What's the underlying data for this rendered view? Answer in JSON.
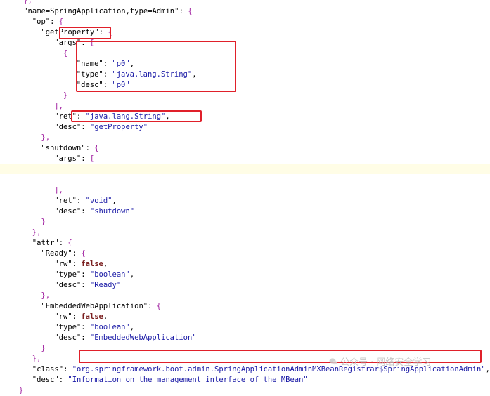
{
  "lines": [
    {
      "i": 4,
      "seg": [
        {
          "c": "p",
          "t": "},"
        }
      ]
    },
    {
      "i": 4,
      "seg": [
        {
          "c": "k",
          "t": "\"name=SpringApplication,type=Admin\""
        },
        {
          "c": "k",
          "t": ": "
        },
        {
          "c": "p",
          "t": "{"
        }
      ]
    },
    {
      "i": 6,
      "seg": [
        {
          "c": "k",
          "t": "\"op\""
        },
        {
          "c": "k",
          "t": ": "
        },
        {
          "c": "p",
          "t": "{"
        }
      ]
    },
    {
      "i": 8,
      "seg": [
        {
          "c": "k",
          "t": "\"getProperty\""
        },
        {
          "c": "k",
          "t": ": "
        },
        {
          "c": "p",
          "t": "{"
        }
      ]
    },
    {
      "i": 11,
      "seg": [
        {
          "c": "k",
          "t": "\"args\""
        },
        {
          "c": "k",
          "t": ": "
        },
        {
          "c": "p",
          "t": "["
        }
      ]
    },
    {
      "i": 13,
      "seg": [
        {
          "c": "p",
          "t": "{"
        }
      ]
    },
    {
      "i": 16,
      "seg": [
        {
          "c": "k",
          "t": "\"name\""
        },
        {
          "c": "k",
          "t": ": "
        },
        {
          "c": "s",
          "t": "\"p0\""
        },
        {
          "c": "k",
          "t": ","
        }
      ]
    },
    {
      "i": 16,
      "seg": [
        {
          "c": "k",
          "t": "\"type\""
        },
        {
          "c": "k",
          "t": ": "
        },
        {
          "c": "s",
          "t": "\"java.lang.String\""
        },
        {
          "c": "k",
          "t": ","
        }
      ]
    },
    {
      "i": 16,
      "seg": [
        {
          "c": "k",
          "t": "\"desc\""
        },
        {
          "c": "k",
          "t": ": "
        },
        {
          "c": "s",
          "t": "\"p0\""
        }
      ]
    },
    {
      "i": 13,
      "seg": [
        {
          "c": "p",
          "t": "}"
        }
      ]
    },
    {
      "i": 11,
      "seg": [
        {
          "c": "p",
          "t": "],"
        }
      ]
    },
    {
      "i": 11,
      "seg": [
        {
          "c": "k",
          "t": "\"ret\""
        },
        {
          "c": "k",
          "t": ": "
        },
        {
          "c": "s",
          "t": "\"java.lang.String\""
        },
        {
          "c": "k",
          "t": ","
        }
      ]
    },
    {
      "i": 11,
      "seg": [
        {
          "c": "k",
          "t": "\"desc\""
        },
        {
          "c": "k",
          "t": ": "
        },
        {
          "c": "s",
          "t": "\"getProperty\""
        }
      ]
    },
    {
      "i": 8,
      "seg": [
        {
          "c": "p",
          "t": "},"
        }
      ]
    },
    {
      "i": 8,
      "seg": [
        {
          "c": "k",
          "t": "\"shutdown\""
        },
        {
          "c": "k",
          "t": ": "
        },
        {
          "c": "p",
          "t": "{"
        }
      ]
    },
    {
      "i": 11,
      "seg": [
        {
          "c": "k",
          "t": "\"args\""
        },
        {
          "c": "k",
          "t": ": "
        },
        {
          "c": "p",
          "t": "["
        }
      ]
    },
    {
      "i": 0,
      "seg": []
    },
    {
      "i": 0,
      "seg": []
    },
    {
      "i": 11,
      "seg": [
        {
          "c": "p",
          "t": "],"
        }
      ]
    },
    {
      "i": 11,
      "seg": [
        {
          "c": "k",
          "t": "\"ret\""
        },
        {
          "c": "k",
          "t": ": "
        },
        {
          "c": "s",
          "t": "\"void\""
        },
        {
          "c": "k",
          "t": ","
        }
      ]
    },
    {
      "i": 11,
      "seg": [
        {
          "c": "k",
          "t": "\"desc\""
        },
        {
          "c": "k",
          "t": ": "
        },
        {
          "c": "s",
          "t": "\"shutdown\""
        }
      ]
    },
    {
      "i": 8,
      "seg": [
        {
          "c": "p",
          "t": "}"
        }
      ]
    },
    {
      "i": 6,
      "seg": [
        {
          "c": "p",
          "t": "},"
        }
      ]
    },
    {
      "i": 6,
      "seg": [
        {
          "c": "k",
          "t": "\"attr\""
        },
        {
          "c": "k",
          "t": ": "
        },
        {
          "c": "p",
          "t": "{"
        }
      ]
    },
    {
      "i": 8,
      "seg": [
        {
          "c": "k",
          "t": "\"Ready\""
        },
        {
          "c": "k",
          "t": ": "
        },
        {
          "c": "p",
          "t": "{"
        }
      ]
    },
    {
      "i": 11,
      "seg": [
        {
          "c": "k",
          "t": "\"rw\""
        },
        {
          "c": "k",
          "t": ": "
        },
        {
          "c": "kw",
          "t": "false"
        },
        {
          "c": "k",
          "t": ","
        }
      ]
    },
    {
      "i": 11,
      "seg": [
        {
          "c": "k",
          "t": "\"type\""
        },
        {
          "c": "k",
          "t": ": "
        },
        {
          "c": "s",
          "t": "\"boolean\""
        },
        {
          "c": "k",
          "t": ","
        }
      ]
    },
    {
      "i": 11,
      "seg": [
        {
          "c": "k",
          "t": "\"desc\""
        },
        {
          "c": "k",
          "t": ": "
        },
        {
          "c": "s",
          "t": "\"Ready\""
        }
      ]
    },
    {
      "i": 8,
      "seg": [
        {
          "c": "p",
          "t": "},"
        }
      ]
    },
    {
      "i": 8,
      "seg": [
        {
          "c": "k",
          "t": "\"EmbeddedWebApplication\""
        },
        {
          "c": "k",
          "t": ": "
        },
        {
          "c": "p",
          "t": "{"
        }
      ]
    },
    {
      "i": 11,
      "seg": [
        {
          "c": "k",
          "t": "\"rw\""
        },
        {
          "c": "k",
          "t": ": "
        },
        {
          "c": "kw",
          "t": "false"
        },
        {
          "c": "k",
          "t": ","
        }
      ]
    },
    {
      "i": 11,
      "seg": [
        {
          "c": "k",
          "t": "\"type\""
        },
        {
          "c": "k",
          "t": ": "
        },
        {
          "c": "s",
          "t": "\"boolean\""
        },
        {
          "c": "k",
          "t": ","
        }
      ]
    },
    {
      "i": 11,
      "seg": [
        {
          "c": "k",
          "t": "\"desc\""
        },
        {
          "c": "k",
          "t": ": "
        },
        {
          "c": "s",
          "t": "\"EmbeddedWebApplication\""
        }
      ]
    },
    {
      "i": 8,
      "seg": [
        {
          "c": "p",
          "t": "}"
        }
      ]
    },
    {
      "i": 6,
      "seg": [
        {
          "c": "p",
          "t": "},"
        }
      ]
    },
    {
      "i": 6,
      "seg": [
        {
          "c": "k",
          "t": "\"class\""
        },
        {
          "c": "k",
          "t": ": "
        },
        {
          "c": "s",
          "t": "\"org.springframework.boot.admin.SpringApplicationAdminMXBeanRegistrar$SpringApplicationAdmin\""
        },
        {
          "c": "k",
          "t": ","
        }
      ]
    },
    {
      "i": 6,
      "seg": [
        {
          "c": "k",
          "t": "\"desc\""
        },
        {
          "c": "k",
          "t": ": "
        },
        {
          "c": "s",
          "t": "\"Information on the management interface of the MBean\""
        }
      ]
    },
    {
      "i": 3,
      "seg": [
        {
          "c": "p",
          "t": "}"
        }
      ]
    }
  ],
  "watermark": "公众号 · 网络安全学习"
}
